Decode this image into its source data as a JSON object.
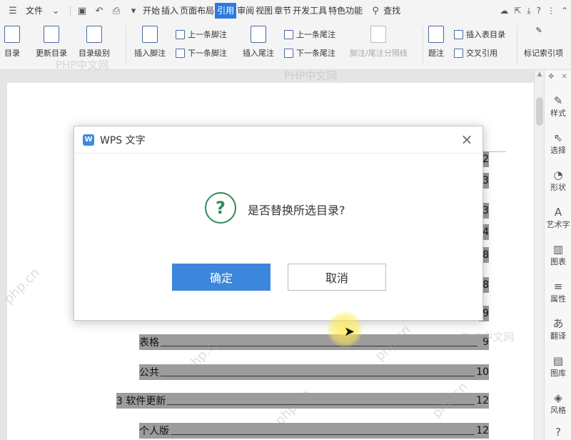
{
  "menubar": {
    "file_label": "文件",
    "tabs": [
      "开始",
      "插入",
      "页面布局",
      "引用",
      "审阅",
      "视图",
      "章节",
      "开发工具",
      "特色功能"
    ],
    "active_tab": "引用",
    "search_label": "查找"
  },
  "ribbon": {
    "toc": "目录",
    "update_toc": "更新目录",
    "toc_level": "目录级别",
    "insert_footnote": "插入脚注",
    "prev_footnote": "上一条脚注",
    "next_footnote": "下一条脚注",
    "insert_endnote": "插入尾注",
    "prev_endnote": "上一条尾注",
    "next_endnote": "下一条尾注",
    "footnote_separator": "脚注/尾注分隔线",
    "caption": "题注",
    "insert_table_of_figures": "插入表目录",
    "cross_reference": "交叉引用",
    "mark_index": "标记索引项"
  },
  "document": {
    "toc_numbers_right": [
      "2",
      "3",
      "3",
      "4",
      "8",
      "8",
      "9"
    ],
    "toc_entries": [
      {
        "text": "表格",
        "page": "9"
      },
      {
        "text": "公共",
        "page": "10"
      },
      {
        "text": "3 软件更新",
        "page": "12"
      },
      {
        "text": "个人版",
        "page": "12"
      }
    ]
  },
  "sidepanel": {
    "items": [
      "样式",
      "选择",
      "形状",
      "艺术字",
      "图表",
      "属性",
      "翻译",
      "图库",
      "风格"
    ]
  },
  "watermarks": [
    "PHP中文网",
    "PHP中文网",
    "PHP中文网",
    "PHP中文网",
    "php.cn",
    "php.cn",
    "php.cn",
    "php.cn",
    "php.cn"
  ],
  "dialog": {
    "title": "WPS 文字",
    "logo": "W",
    "message": "是否替换所选目录?",
    "ok_label": "确定",
    "cancel_label": "取消"
  }
}
